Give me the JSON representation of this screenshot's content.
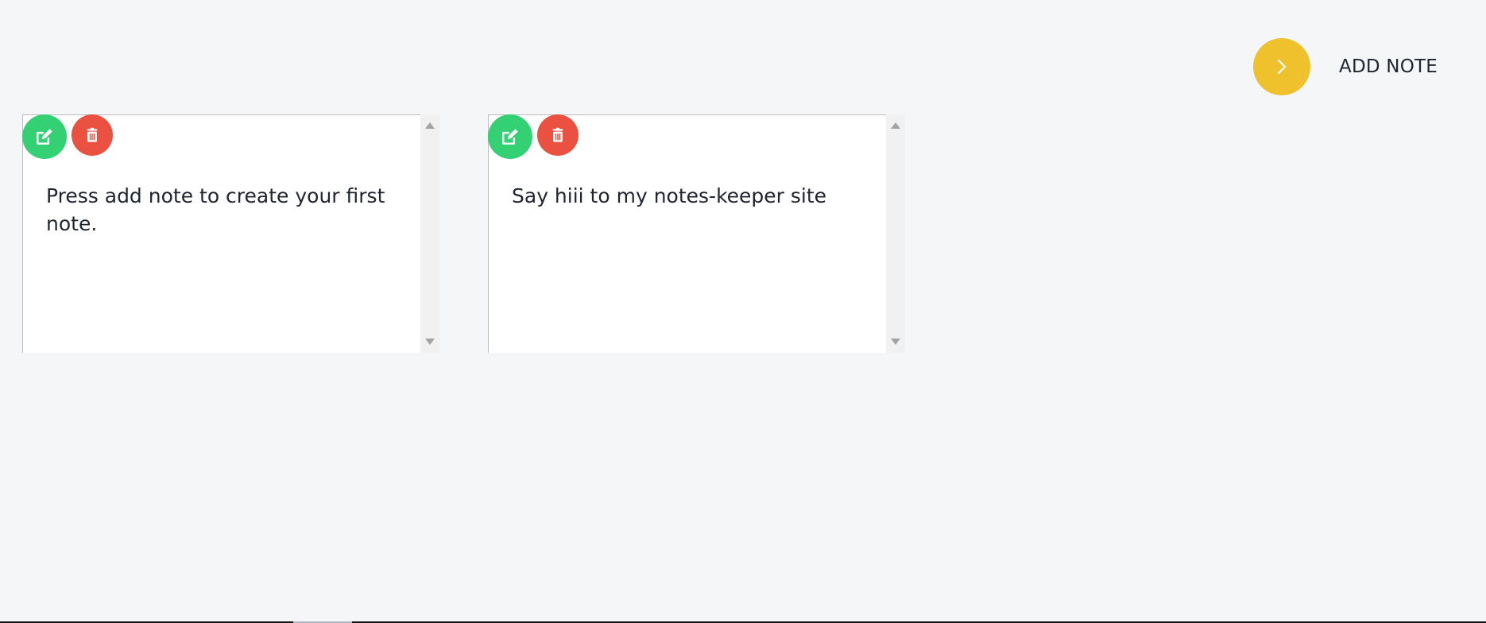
{
  "header": {
    "add_note_label": "ADD NOTE",
    "add_icon": "chevron-right-icon",
    "accent_color": "#efc12d"
  },
  "notes": [
    {
      "text": "Press add note to create your first note.",
      "edit_icon": "edit-icon",
      "delete_icon": "trash-icon"
    },
    {
      "text": "Say hiii to my notes-keeper site",
      "edit_icon": "edit-icon",
      "delete_icon": "trash-icon"
    }
  ],
  "colors": {
    "edit": "#34d174",
    "delete": "#ea5140",
    "page_bg": "#f5f6f7",
    "card_bg": "#ffffff"
  }
}
